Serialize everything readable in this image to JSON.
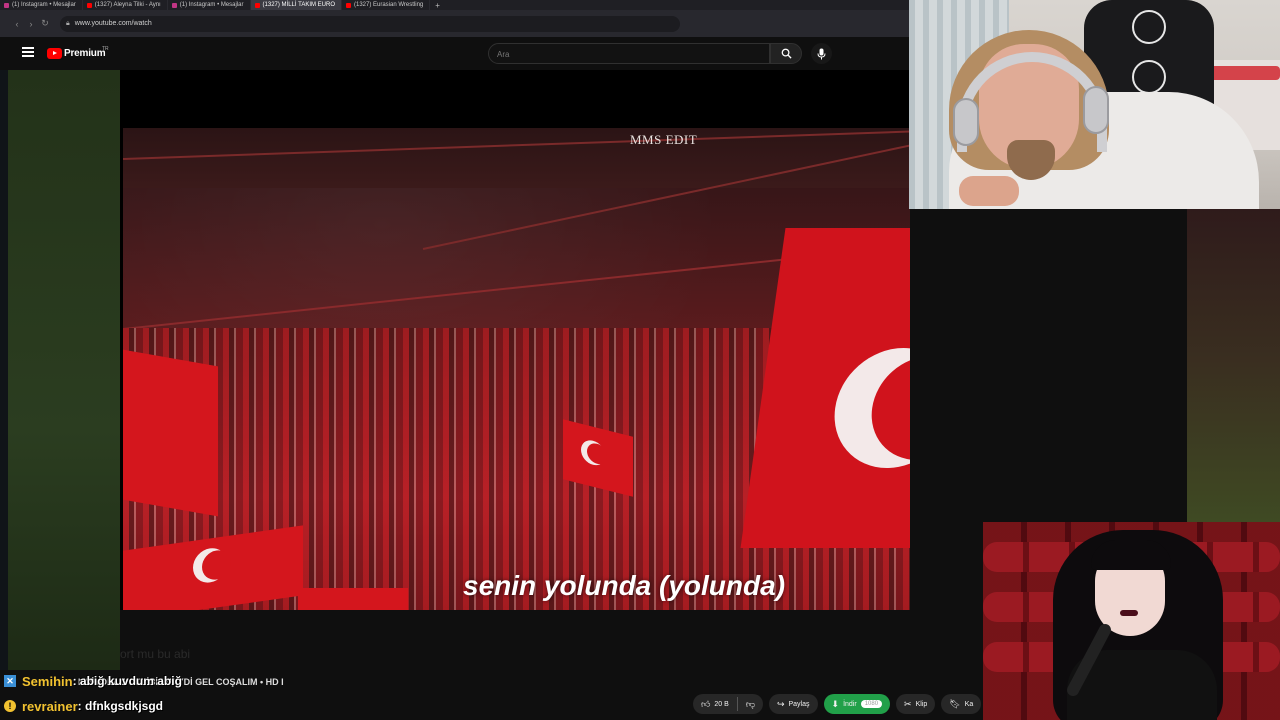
{
  "browser": {
    "tabs": [
      {
        "label": "(1) Instagram • Mesajlar",
        "icon": "instagram-icon",
        "active": false
      },
      {
        "label": "(1327) Aleyna Tilki - Aynı",
        "icon": "youtube-icon",
        "active": false
      },
      {
        "label": "(1) Instagram • Mesajlar",
        "icon": "instagram-icon",
        "active": false
      },
      {
        "label": "(1327) MİLLİ TAKIM EURO",
        "icon": "youtube-icon",
        "active": true
      },
      {
        "label": "(1327) Eurasian Wrestling",
        "icon": "youtube-icon",
        "active": false
      }
    ],
    "new_tab": "+",
    "url": "www.youtube.com/watch"
  },
  "youtube": {
    "brand": "Premium",
    "region": "TR",
    "search_placeholder": "Ara"
  },
  "video": {
    "watermark": "MMS EDIT",
    "lyric": "senin yolunda (yolunda)"
  },
  "below": {
    "faded_comment": "ort mu bu abi",
    "title_fragment": "MPİYONLUK KLİBİ I HAYDİ GEL COŞALIM • HD I"
  },
  "actions": {
    "like_count": "20 B",
    "share": "Paylaş",
    "download": "İndir",
    "quality": "1080",
    "clip": "Klip",
    "save": "Ka"
  },
  "chat": [
    {
      "user": "Semihin",
      "message": ": abiğ kuvdum abiğ",
      "user_color": "#f2c230",
      "badge": "x-icon"
    },
    {
      "user": "revrainer",
      "message": ": dfnkgsdkjsgd",
      "user_color": "#f2c230",
      "badge": "warning-icon"
    }
  ]
}
